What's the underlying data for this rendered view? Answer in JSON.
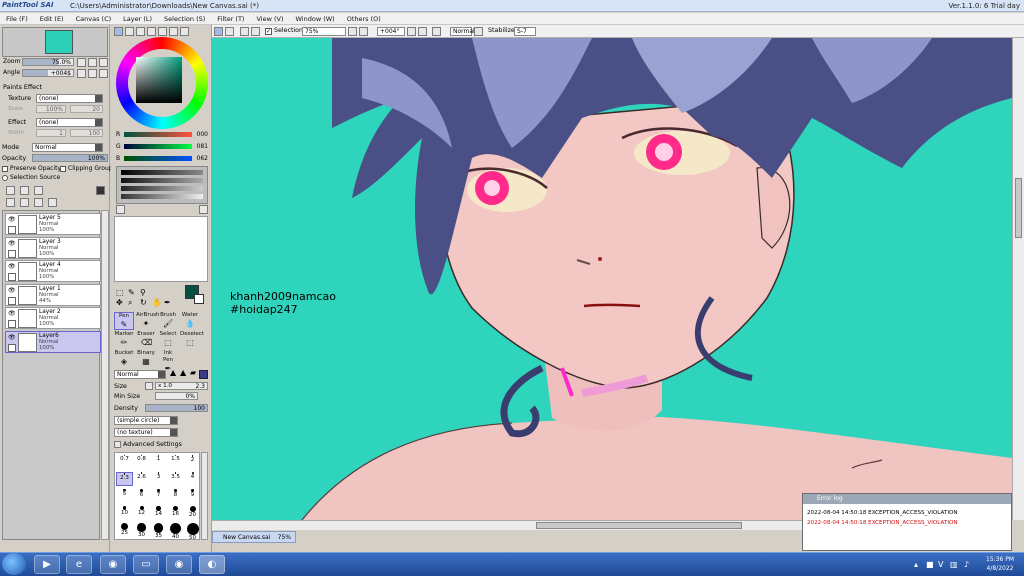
{
  "titlebar": {
    "app_logo": "PaintTool SAI",
    "path": "C:\\Users\\Administrator\\Downloads\\New Canvas.sai (*)",
    "version": "Ver.1.1.0: 6 Trial day"
  },
  "menubar": {
    "items": [
      "File (F)",
      "Edit (E)",
      "Canvas (C)",
      "Layer (L)",
      "Selection (S)",
      "Filter (T)",
      "View (V)",
      "Window (W)",
      "Others (O)"
    ]
  },
  "navigator": {
    "zoom_label": "Zoom",
    "zoom_value": "75.0%",
    "angle_label": "Angle",
    "angle_value": "+004$"
  },
  "paints_effect": {
    "header": "Paints Effect",
    "texture_label": "Texture",
    "texture_value": "(none)",
    "scale_label": "Scale",
    "scale_value": "100%",
    "scale_num": "20",
    "effect_label": "Effect",
    "effect_value": "(none)",
    "width_label": "Width",
    "width_value": "1",
    "width_num": "100"
  },
  "layer_props": {
    "mode_label": "Mode",
    "mode_value": "Normal",
    "opacity_label": "Opacity",
    "opacity_value": "100%",
    "opacity_fraction": 1.0,
    "preserve_opacity": "Preserve Opacity",
    "clipping_group": "Clipping Group",
    "selection_source": "Selection Source"
  },
  "layers": [
    {
      "name": "Layer 5",
      "mode": "Normal",
      "opacity": "100%",
      "selected": false
    },
    {
      "name": "Layer 3",
      "mode": "Normal",
      "opacity": "100%",
      "selected": false
    },
    {
      "name": "Layer 4",
      "mode": "Normal",
      "opacity": "100%",
      "selected": false
    },
    {
      "name": "Layer 1",
      "mode": "Normal",
      "opacity": "44%",
      "selected": false
    },
    {
      "name": "Layer 2",
      "mode": "Normal",
      "opacity": "100%",
      "selected": false
    },
    {
      "name": "Layer6",
      "mode": "Normal",
      "opacity": "100%",
      "selected": true
    }
  ],
  "color": {
    "r_label": "R",
    "r_value": "000",
    "g_label": "G",
    "g_value": "081",
    "b_label": "B",
    "b_value": "062",
    "current_color": "#00513e"
  },
  "tools": {
    "row1": [
      {
        "label": "Pen",
        "selected": true
      },
      {
        "label": "AirBrush",
        "selected": false
      },
      {
        "label": "Brush",
        "selected": false
      },
      {
        "label": "Water",
        "selected": false
      }
    ],
    "row2": [
      {
        "label": "Marker",
        "selected": false
      },
      {
        "label": "Eraser",
        "selected": false
      },
      {
        "label": "Select",
        "selected": false
      },
      {
        "label": "Deselect",
        "selected": false
      }
    ],
    "row3": [
      {
        "label": "Bucket",
        "selected": false
      },
      {
        "label": "Binary",
        "selected": false
      },
      {
        "label": "Ink Pen",
        "selected": false
      }
    ]
  },
  "brush": {
    "mode_value": "Normal",
    "size_label": "Size",
    "size_mult": "x 1.0",
    "size_value": "2.3",
    "minsize_label": "Min Size",
    "minsize_value": "0%",
    "density_label": "Density",
    "density_value": "100",
    "shape_value": "(simple circle)",
    "texture_value": "(no texture)",
    "advanced": "Advanced Settings",
    "sizes": [
      "0.7",
      "0.8",
      "1",
      "1.5",
      "2",
      "2.3",
      "2.6",
      "3",
      "3.5",
      "4",
      "5",
      "6",
      "7",
      "8",
      "9",
      "10",
      "12",
      "14",
      "16",
      "20",
      "25",
      "30",
      "35",
      "40",
      "50"
    ],
    "selected_size": "2.3"
  },
  "topbar": {
    "selection_label": "Selection",
    "zoom_value": "75%",
    "angle_value": "+004°",
    "mode_value": "Normal",
    "stabilizer_label": "Stabilizer",
    "stabilizer_value": "S-7"
  },
  "canvas": {
    "bg_color": "#2ed4bb",
    "watermark_line1": "khanh2009namcao",
    "watermark_line2": "#hoidap247"
  },
  "tab": {
    "name": "New Canvas.sai",
    "zoom": "75%"
  },
  "error_log": {
    "title": "Error log",
    "line1": "2022-08-04 14:50:18 EXCEPTION_ACCESS_VIOLATION",
    "line2": "2022-08-04 14:50:18 EXCEPTION_ACCESS_VIOLATION"
  },
  "taskbar": {
    "time": "15:36 PM",
    "date": "4/8/2022"
  }
}
